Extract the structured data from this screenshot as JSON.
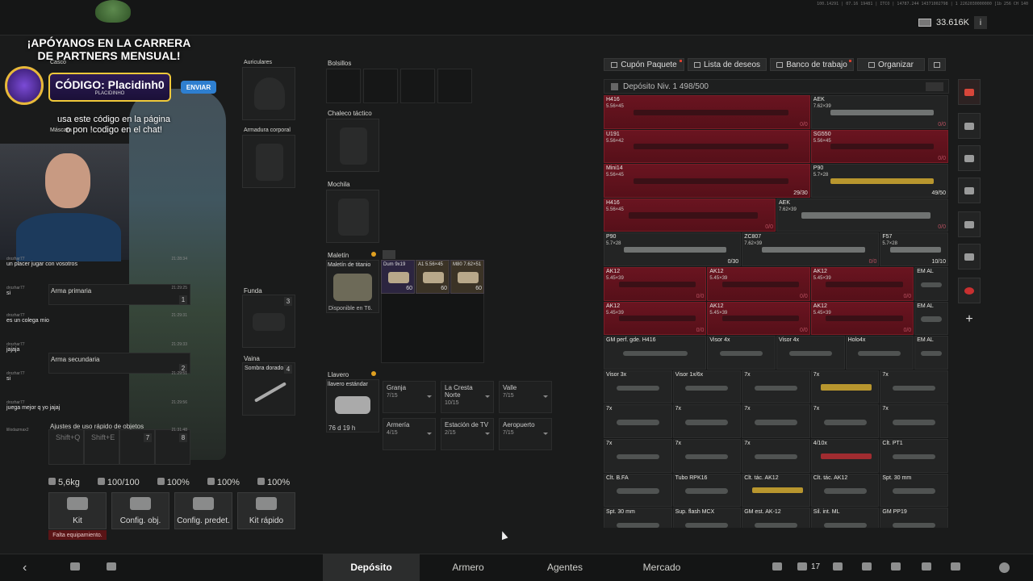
{
  "header": {
    "money": "33.616K",
    "info_label": "i",
    "hardware_id": "100.14291 | 07.16 19481 | ITCO | 14787.244 14371002798 | 1 2262030000000 [1b 256 CH 140"
  },
  "promo": {
    "line1": "¡APÓYANOS EN LA CARRERA",
    "line2": "DE PARTNERS MENSUAL!",
    "code": "CÓDIGO: Placidinh0",
    "code_sub": "PLACIDINHO",
    "send": "ENVIAR",
    "hint1": "usa este código en la página",
    "hint2": "o pon !codigo en el chat!"
  },
  "gear": {
    "casco": "Casco",
    "auriculares": "Auriculares",
    "armadura": "Armadura corporal",
    "mascara": "Máscara",
    "funda": "Funda",
    "funda_count": "3",
    "vaina": "Vaina",
    "vaina_item": "Sombra dorado",
    "vaina_count": "4",
    "arma_primaria": "Arma primaria",
    "arma_primaria_num": "1",
    "arma_secundaria": "Arma secundaria",
    "arma_secundaria_num": "2",
    "ajustes": "Ajustes de uso rápido de objetos",
    "shift_q": "Shift+Q",
    "shift_e": "Shift+E",
    "slot7": "7",
    "slot8": "8"
  },
  "chat": [
    {
      "user": "drozhar77",
      "time": "21:28:34",
      "msg": "un placer jugar con vosotros"
    },
    {
      "user": "drozhar77",
      "time": "21:29:25",
      "msg": "si"
    },
    {
      "user": "drozhar77",
      "time": "21:29:31",
      "msg": "es un colega mio"
    },
    {
      "user": "drozhar77",
      "time": "21:29:33",
      "msg": "jajaja"
    },
    {
      "user": "drozhar77",
      "time": "21:29:51",
      "msg": "si"
    },
    {
      "user": "drozhar77",
      "time": "21:29:56",
      "msg": "juega mejor q yo jajaj"
    },
    {
      "user": "lillodazmax2",
      "time": "21:31:48",
      "msg": ""
    }
  ],
  "inventory": {
    "bolsillos": "Bolsillos",
    "chaleco": "Chaleco táctico",
    "mochila": "Mochila",
    "maletin": "Maletín",
    "maletin_item": "Maletín de titanio",
    "maletin_status": "Disponible en T6.",
    "ammo": [
      {
        "name": "Dum 9x19",
        "count": "60"
      },
      {
        "name": "A1 5.56×45",
        "count": "60"
      },
      {
        "name": "M80 7.62×51",
        "count": "60"
      }
    ],
    "llavero": "Llavero",
    "llavero_item": "llavero estándar",
    "llavero_time": "76 d 19 h",
    "crafting": [
      {
        "name": "Granja",
        "value": "7/15"
      },
      {
        "name": "La Cresta Norte",
        "value": "10/15"
      },
      {
        "name": "Valle",
        "value": "7/15"
      },
      {
        "name": "Armería",
        "value": "4/15"
      },
      {
        "name": "Estación de TV",
        "value": "2/15"
      },
      {
        "name": "Aeropuerto",
        "value": "7/15"
      }
    ]
  },
  "stats": {
    "weight": "5,6kg",
    "s1": "100/100",
    "s2": "100%",
    "s3": "100%",
    "s4": "100%"
  },
  "actions": {
    "kit": "Kit",
    "config_obj": "Config. obj.",
    "config_predet": "Config. predet.",
    "kit_rapido": "Kit rápido",
    "warning": "Falta equipamiento."
  },
  "stash": {
    "tabs": [
      "Cupón Paquete",
      "Lista de deseos",
      "Banco de trabajo",
      "Organizar"
    ],
    "title": "Depósito Niv. 1 498/500",
    "items": [
      {
        "name": "H416",
        "cal": "5.56×45",
        "count": "0/0",
        "red": true,
        "x": 0,
        "y": 0,
        "w": 3,
        "h": 1,
        "kind": "gun"
      },
      {
        "name": "AEK",
        "cal": "7.62×39",
        "count": "0/0",
        "red": false,
        "x": 3,
        "y": 0,
        "w": 2,
        "h": 1,
        "kind": "gun-grey"
      },
      {
        "name": "U191",
        "cal": "5.56×42",
        "count": "",
        "red": true,
        "x": 0,
        "y": 1,
        "w": 3,
        "h": 1,
        "kind": "gun"
      },
      {
        "name": "SG550",
        "cal": "5.56×45",
        "count": "0/0",
        "red": true,
        "x": 3,
        "y": 1,
        "w": 2,
        "h": 1,
        "kind": "gun"
      },
      {
        "name": "Mini14",
        "cal": "5.56×45",
        "count": "29/30",
        "red": true,
        "x": 0,
        "y": 2,
        "w": 3,
        "h": 1,
        "kind": "gun"
      },
      {
        "name": "P90",
        "cal": "5.7×28",
        "count": "49/50",
        "red": false,
        "x": 3,
        "y": 2,
        "w": 2,
        "h": 1,
        "kind": "gun-gold"
      },
      {
        "name": "H416",
        "cal": "5.56×45",
        "count": "0/0",
        "red": true,
        "x": 0,
        "y": 3,
        "w": 2.5,
        "h": 1,
        "kind": "gun"
      },
      {
        "name": "AEK",
        "cal": "7.62×39",
        "count": "0/0",
        "red": false,
        "x": 2.5,
        "y": 3,
        "w": 2.5,
        "h": 1,
        "kind": "gun-grey"
      },
      {
        "name": "P90",
        "cal": "5.7×28",
        "count": "0/30",
        "red": false,
        "x": 0,
        "y": 4,
        "w": 2,
        "h": 1,
        "kind": "gun-grey"
      },
      {
        "name": "ZC807",
        "cal": "7.62×39",
        "count": "0/0",
        "red": false,
        "x": 2,
        "y": 4,
        "w": 2,
        "h": 1,
        "kind": "gun-grey"
      },
      {
        "name": "F57",
        "cal": "5.7×28",
        "count": "10/10",
        "red": false,
        "x": 4,
        "y": 4,
        "w": 1,
        "h": 1,
        "kind": "gun-grey"
      },
      {
        "name": "AK12",
        "cal": "5.45×39",
        "count": "0/0",
        "red": true,
        "x": 0,
        "y": 5,
        "w": 1.5,
        "h": 1,
        "kind": "gun"
      },
      {
        "name": "AK12",
        "cal": "5.45×39",
        "count": "0/0",
        "red": true,
        "x": 1.5,
        "y": 5,
        "w": 1.5,
        "h": 1,
        "kind": "gun"
      },
      {
        "name": "AK12",
        "cal": "5.45×39",
        "count": "0/0",
        "red": true,
        "x": 3,
        "y": 5,
        "w": 1.5,
        "h": 1,
        "kind": "gun"
      },
      {
        "name": "EM AL",
        "cal": "",
        "count": "",
        "red": false,
        "x": 4.5,
        "y": 5,
        "w": 0.5,
        "h": 1,
        "kind": "scope"
      },
      {
        "name": "AK12",
        "cal": "5.45×39",
        "count": "0/0",
        "red": true,
        "x": 0,
        "y": 6,
        "w": 1.5,
        "h": 1,
        "kind": "gun"
      },
      {
        "name": "AK12",
        "cal": "5.45×39",
        "count": "0/0",
        "red": true,
        "x": 1.5,
        "y": 6,
        "w": 1.5,
        "h": 1,
        "kind": "gun"
      },
      {
        "name": "AK12",
        "cal": "5.45×39",
        "count": "0/0",
        "red": true,
        "x": 3,
        "y": 6,
        "w": 1.5,
        "h": 1,
        "kind": "gun"
      },
      {
        "name": "EM AL",
        "cal": "",
        "count": "",
        "red": false,
        "x": 4.5,
        "y": 6,
        "w": 0.5,
        "h": 1,
        "kind": "scope"
      },
      {
        "name": "GM perf. gde. H416",
        "cal": "",
        "count": "",
        "red": false,
        "x": 0,
        "y": 7,
        "w": 1.5,
        "h": 1,
        "kind": "scope"
      },
      {
        "name": "Visor 4x",
        "cal": "",
        "count": "",
        "red": false,
        "x": 1.5,
        "y": 7,
        "w": 1,
        "h": 1,
        "kind": "scope"
      },
      {
        "name": "Visor 4x",
        "cal": "",
        "count": "",
        "red": false,
        "x": 2.5,
        "y": 7,
        "w": 1,
        "h": 1,
        "kind": "scope"
      },
      {
        "name": "Holo4x",
        "cal": "",
        "count": "",
        "red": false,
        "x": 3.5,
        "y": 7,
        "w": 1,
        "h": 1,
        "kind": "scope"
      },
      {
        "name": "EM AL",
        "cal": "",
        "count": "",
        "red": false,
        "x": 4.5,
        "y": 7,
        "w": 0.5,
        "h": 1,
        "kind": "scope"
      },
      {
        "name": "Visor 3x",
        "cal": "",
        "count": "",
        "red": false,
        "x": 0,
        "y": 8,
        "w": 1,
        "h": 1,
        "kind": "scope"
      },
      {
        "name": "Visor 1x/6x",
        "cal": "",
        "count": "",
        "red": false,
        "x": 1,
        "y": 8,
        "w": 1,
        "h": 1,
        "kind": "scope"
      },
      {
        "name": "7x",
        "cal": "",
        "count": "",
        "red": false,
        "x": 2,
        "y": 8,
        "w": 1,
        "h": 1,
        "kind": "scope"
      },
      {
        "name": "7x",
        "cal": "",
        "count": "",
        "red": false,
        "x": 3,
        "y": 8,
        "w": 1,
        "h": 1,
        "kind": "gun-gold"
      },
      {
        "name": "7x",
        "cal": "",
        "count": "",
        "red": false,
        "x": 4,
        "y": 8,
        "w": 1,
        "h": 1,
        "kind": "scope"
      },
      {
        "name": "7x",
        "cal": "",
        "count": "",
        "red": false,
        "x": 0,
        "y": 9,
        "w": 1,
        "h": 1,
        "kind": "scope"
      },
      {
        "name": "7x",
        "cal": "",
        "count": "",
        "red": false,
        "x": 1,
        "y": 9,
        "w": 1,
        "h": 1,
        "kind": "scope"
      },
      {
        "name": "7x",
        "cal": "",
        "count": "",
        "red": false,
        "x": 2,
        "y": 9,
        "w": 1,
        "h": 1,
        "kind": "scope"
      },
      {
        "name": "7x",
        "cal": "",
        "count": "",
        "red": false,
        "x": 3,
        "y": 9,
        "w": 1,
        "h": 1,
        "kind": "scope"
      },
      {
        "name": "7x",
        "cal": "",
        "count": "",
        "red": false,
        "x": 4,
        "y": 9,
        "w": 1,
        "h": 1,
        "kind": "scope"
      },
      {
        "name": "7x",
        "cal": "",
        "count": "",
        "red": false,
        "x": 0,
        "y": 10,
        "w": 1,
        "h": 1,
        "kind": "scope"
      },
      {
        "name": "7x",
        "cal": "",
        "count": "",
        "red": false,
        "x": 1,
        "y": 10,
        "w": 1,
        "h": 1,
        "kind": "scope"
      },
      {
        "name": "7x",
        "cal": "",
        "count": "",
        "red": false,
        "x": 2,
        "y": 10,
        "w": 1,
        "h": 1,
        "kind": "scope"
      },
      {
        "name": "4/10x",
        "cal": "",
        "count": "",
        "red": false,
        "x": 3,
        "y": 10,
        "w": 1,
        "h": 1,
        "kind": "gun-redx"
      },
      {
        "name": "Clt. PT1",
        "cal": "",
        "count": "",
        "red": false,
        "x": 4,
        "y": 10,
        "w": 1,
        "h": 1,
        "kind": "scope"
      },
      {
        "name": "Clt. B.FA",
        "cal": "",
        "count": "",
        "red": false,
        "x": 0,
        "y": 11,
        "w": 1,
        "h": 1,
        "kind": "scope"
      },
      {
        "name": "Tubo RPK16",
        "cal": "",
        "count": "",
        "red": false,
        "x": 1,
        "y": 11,
        "w": 1,
        "h": 1,
        "kind": "scope"
      },
      {
        "name": "Clt. tác. AK12",
        "cal": "",
        "count": "",
        "red": false,
        "x": 2,
        "y": 11,
        "w": 1,
        "h": 1,
        "kind": "gun-gold"
      },
      {
        "name": "Clt. tác. AK12",
        "cal": "",
        "count": "",
        "red": false,
        "x": 3,
        "y": 11,
        "w": 1,
        "h": 1,
        "kind": "scope"
      },
      {
        "name": "Spt. 30 mm",
        "cal": "",
        "count": "",
        "red": false,
        "x": 4,
        "y": 11,
        "w": 1,
        "h": 1,
        "kind": "scope"
      },
      {
        "name": "Spt. 30 mm",
        "cal": "",
        "count": "",
        "red": false,
        "x": 0,
        "y": 12,
        "w": 1,
        "h": 1,
        "kind": "scope"
      },
      {
        "name": "Sup. flash MCX",
        "cal": "",
        "count": "",
        "red": false,
        "x": 1,
        "y": 12,
        "w": 1,
        "h": 1,
        "kind": "scope"
      },
      {
        "name": "GM est. AK-12",
        "cal": "",
        "count": "",
        "red": false,
        "x": 2,
        "y": 12,
        "w": 1,
        "h": 1,
        "kind": "scope"
      },
      {
        "name": "Sil. int. ML",
        "cal": "",
        "count": "",
        "red": false,
        "x": 3,
        "y": 12,
        "w": 1,
        "h": 1,
        "kind": "scope"
      },
      {
        "name": "GM PP19",
        "cal": "",
        "count": "",
        "red": false,
        "x": 4,
        "y": 12,
        "w": 1,
        "h": 1,
        "kind": "scope"
      }
    ]
  },
  "nav": {
    "tabs": [
      "Depósito",
      "Armero",
      "Agentes",
      "Mercado"
    ],
    "friends_count": "17",
    "back_icon": "chevron-left-icon"
  },
  "colors": {
    "accent_red": "#6a1420",
    "warning": "#5a1416"
  }
}
